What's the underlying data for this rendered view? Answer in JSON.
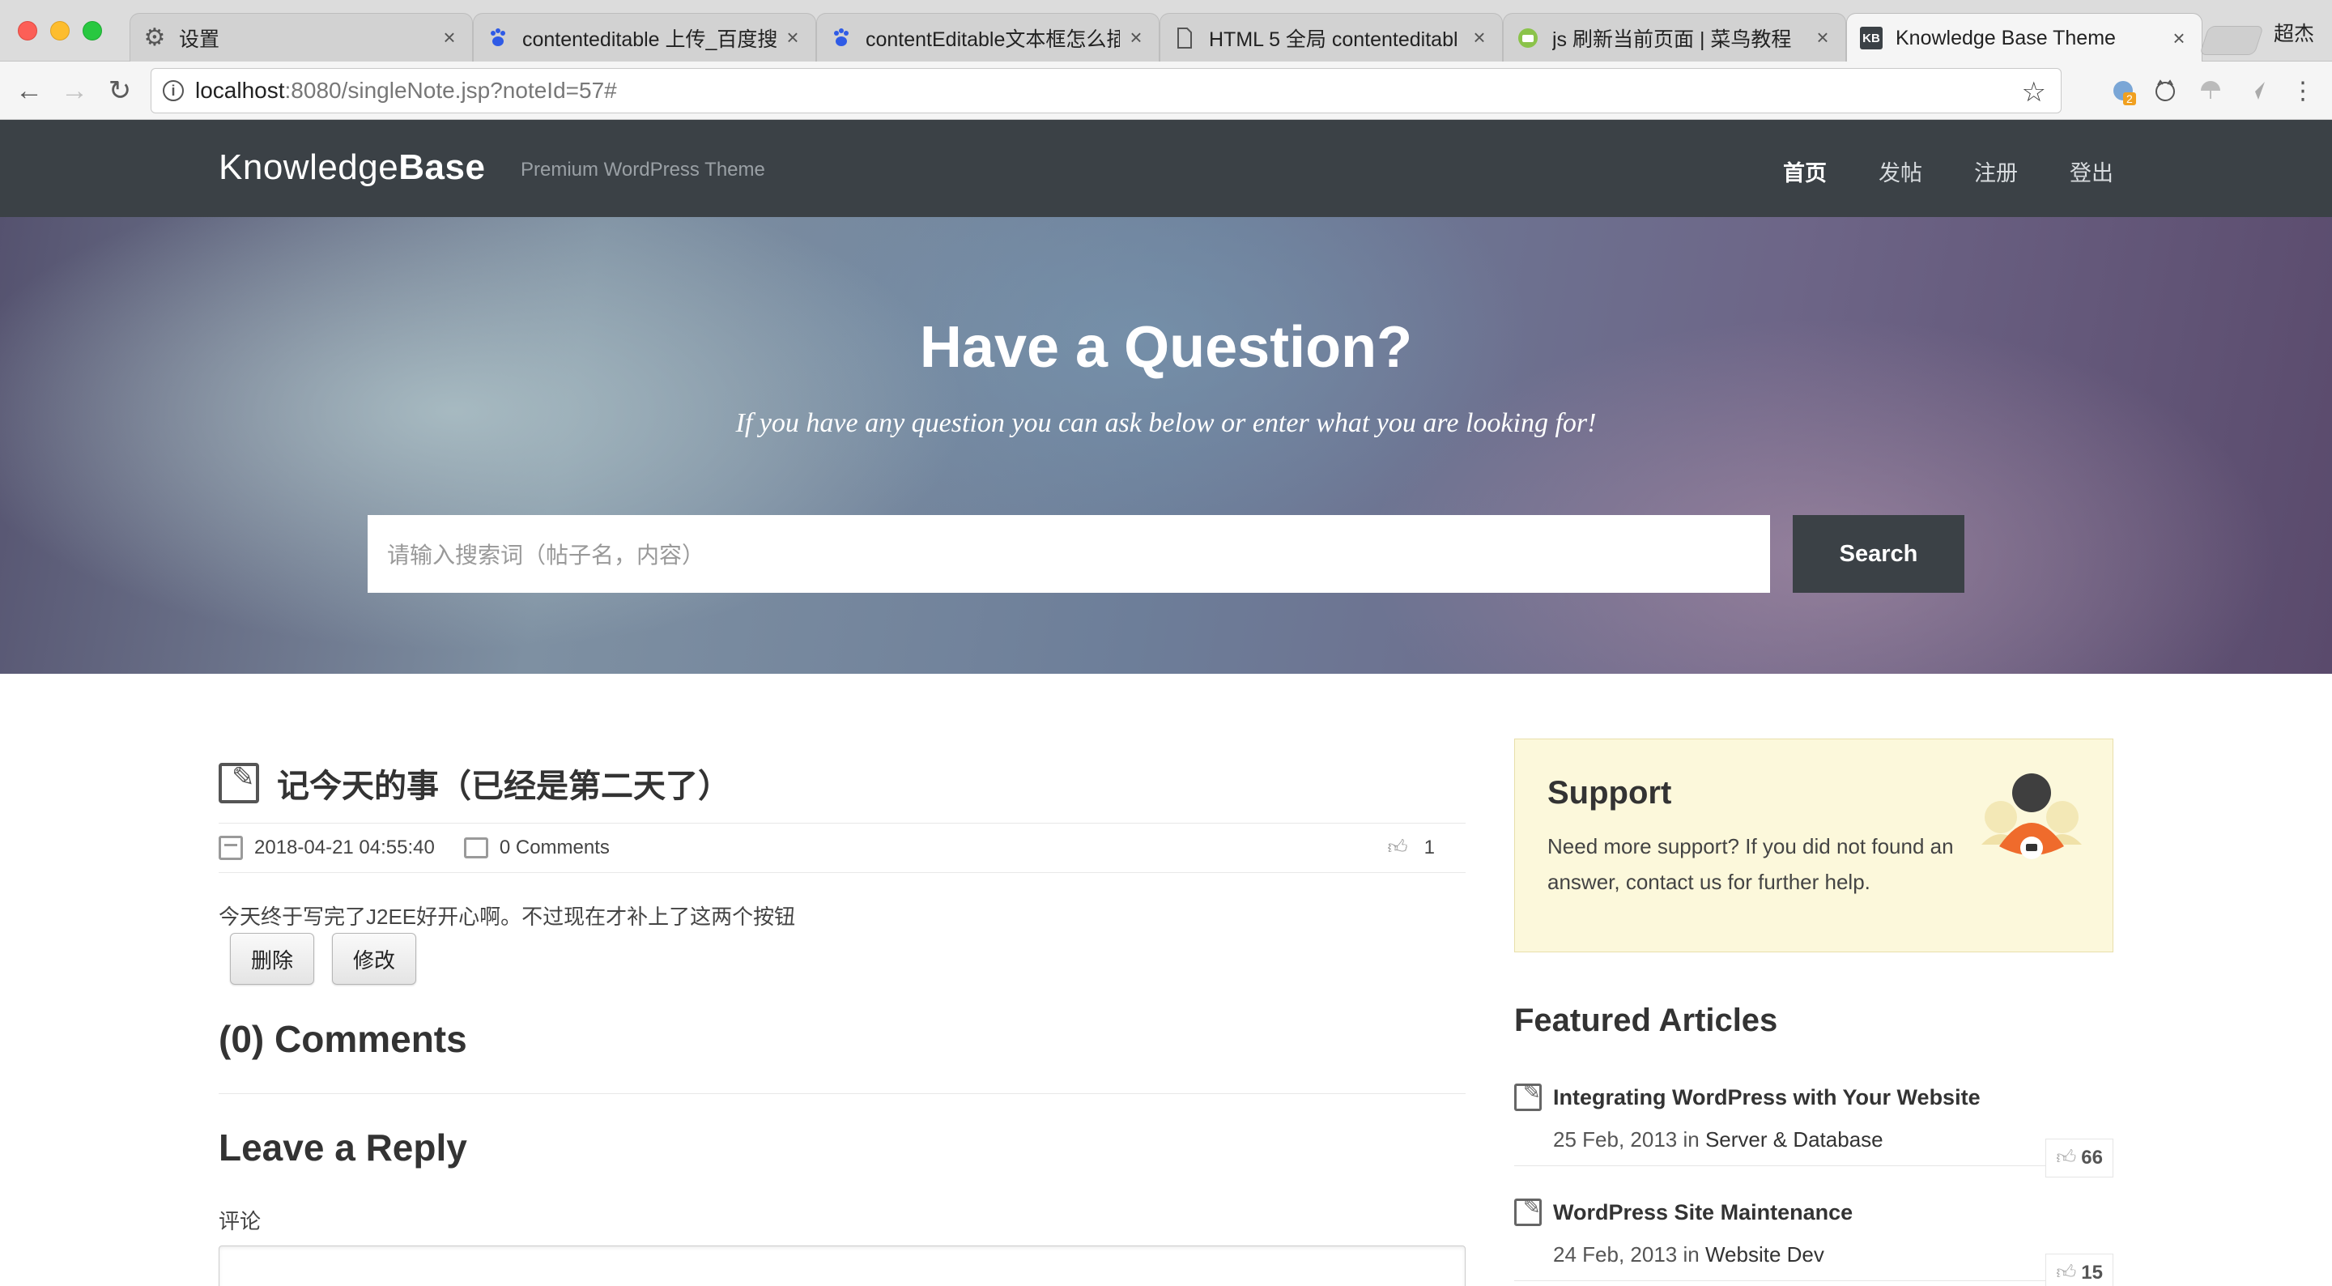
{
  "browser": {
    "tabs": [
      {
        "title": "设置",
        "icon": "gear-icon"
      },
      {
        "title": "contenteditable 上传_百度搜",
        "icon": "baidu-paw-icon"
      },
      {
        "title": "contentEditable文本框怎么插",
        "icon": "baidu-paw-icon"
      },
      {
        "title": "HTML 5 全局 contenteditabl",
        "icon": "document-icon"
      },
      {
        "title": "js 刷新当前页面 | 菜鸟教程",
        "icon": "runoob-icon"
      },
      {
        "title": "Knowledge Base Theme",
        "icon": "kb-icon"
      }
    ],
    "profile_name": "超杰",
    "url_host": "localhost",
    "url_path": ":8080/singleNote.jsp?noteId=57#",
    "extension_badge": "2"
  },
  "site": {
    "logo_light": "Knowledge",
    "logo_bold": "Base",
    "tagline": "Premium WordPress Theme",
    "nav": [
      "首页",
      "发帖",
      "注册",
      "登出"
    ]
  },
  "hero": {
    "title": "Have a Question?",
    "subtitle": "If you have any question you can ask below or enter what you are looking for!",
    "search_placeholder": "请输入搜索词（帖子名，内容）",
    "search_button": "Search"
  },
  "post": {
    "title": "记今天的事（已经是第二天了）",
    "date": "2018-04-21 04:55:40",
    "comments": "0 Comments",
    "likes": "1",
    "body": "今天终于写完了J2EE好开心啊。不过现在才补上了这两个按钮",
    "delete_label": "删除",
    "edit_label": "修改"
  },
  "comments_section": {
    "title": "(0) Comments",
    "reply_title": "Leave a Reply",
    "comment_label": "评论"
  },
  "sidebar": {
    "support": {
      "title": "Support",
      "text": "Need more support? If you did not found an answer, contact us for further help."
    },
    "featured_title": "Featured Articles",
    "articles": [
      {
        "title": "Integrating WordPress with Your Website",
        "date": "25 Feb, 2013",
        "in": "in",
        "category": "Server & Database",
        "likes": "66"
      },
      {
        "title": "WordPress Site Maintenance",
        "date": "24 Feb, 2013",
        "in": "in",
        "category": "Website Dev",
        "likes": "15"
      }
    ]
  },
  "colors": {
    "header_bg": "#3b4146",
    "support_bg": "#fcf8db",
    "accent_orange": "#ef6b2c"
  }
}
